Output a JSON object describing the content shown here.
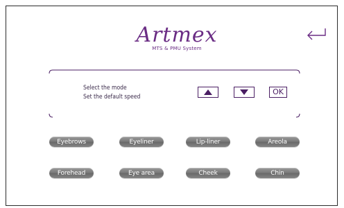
{
  "app": {
    "logo_text": "Artmex",
    "logo_subtitle": "MTS & PMU System"
  },
  "icons": {
    "back": "return-arrow-icon",
    "up": "triangle-up-icon",
    "down": "triangle-down-icon"
  },
  "panel": {
    "line1": "Select the mode",
    "line2": "Set the default speed",
    "ok_label": "OK"
  },
  "modes": {
    "row1": [
      "Eyebrows",
      "Eyeliner",
      "Lip-liner",
      "Areola"
    ],
    "row2": [
      "Forehead",
      "Eye area",
      "Cheek",
      "Chin"
    ]
  },
  "colors": {
    "brand": "#6a2c84",
    "button_border": "#4a1e63",
    "pill": "#7c7c7c"
  }
}
